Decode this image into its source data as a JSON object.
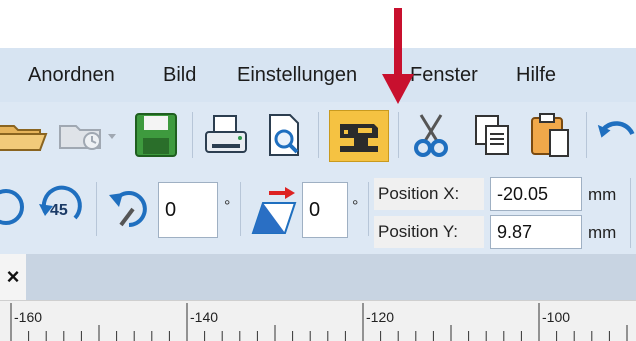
{
  "menu": {
    "items": [
      "Anordnen",
      "Bild",
      "Einstellungen",
      "Fenster",
      "Hilfe"
    ]
  },
  "toolbar": {
    "icons": [
      "open-folder-icon",
      "recent-files-icon",
      "save-icon",
      "print-icon",
      "print-preview-icon",
      "sewing-machine-icon",
      "cut-icon",
      "copy-icon",
      "paste-icon",
      "undo-icon"
    ],
    "active_icon": "sewing-machine-icon"
  },
  "transform": {
    "rotate45_label": "45",
    "rotate_value": "0",
    "rotate_unit": "°",
    "skew_value": "0",
    "skew_unit": "°",
    "position_x_label": "Position X:",
    "position_x_value": "-20.05",
    "position_x_unit": "mm",
    "position_y_label": "Position Y:",
    "position_y_value": "9.87",
    "position_y_unit": "mm"
  },
  "tab": {
    "close_label": "×"
  },
  "ruler": {
    "labels": [
      "-160",
      "-140",
      "-120",
      "-100"
    ]
  },
  "colors": {
    "menubar": "#d7e4f2",
    "toolbar": "#dde8f4",
    "active_button": "#f5c242",
    "arrow": "#c8102e"
  }
}
